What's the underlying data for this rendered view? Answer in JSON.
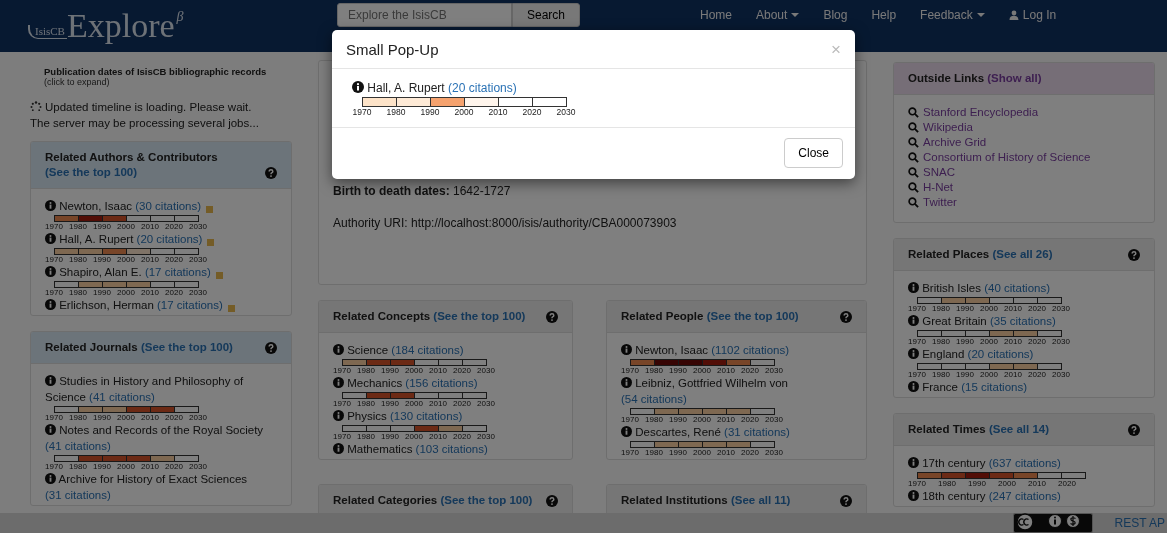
{
  "navbar": {
    "logo": "IsisCB",
    "brand": "Explore",
    "beta": "β",
    "search_placeholder": "Explore the IsisCB",
    "search_button": "Search",
    "links": [
      {
        "label": "Home",
        "kind": "plain"
      },
      {
        "label": "About",
        "kind": "dropdown"
      },
      {
        "label": "Blog",
        "kind": "plain"
      },
      {
        "label": "Help",
        "kind": "plain"
      },
      {
        "label": "Feedback",
        "kind": "dropdown"
      },
      {
        "label": "Log In",
        "kind": "user"
      }
    ]
  },
  "left": {
    "timeline_title": "Publication dates of IsisCB bibliographic records",
    "timeline_hint": "(click to expand)",
    "loading": [
      "Updated timeline is loading. Please wait.",
      "The server may be processing several jobs..."
    ],
    "panels": [
      {
        "kind": "info",
        "title": "Related Authors & Contributors",
        "link": "(See the top 100)",
        "help": true,
        "items": [
          {
            "name": "Newton, Isaac",
            "citations": "(30 citations)",
            "marked": true,
            "segments": [
              {
                "color": "#784528"
              },
              {
                "color": "#520e07"
              },
              {
                "color": "#6c2a15"
              },
              {
                "color": "#7f7f7f"
              },
              {
                "color": "#7f7f7f"
              },
              {
                "color": "#7f7f7f"
              }
            ],
            "ticks": [
              "1970",
              "1980",
              "1990",
              "2000",
              "2010",
              "2020",
              "2030"
            ]
          },
          {
            "name": "Hall, A. Rupert",
            "citations": "(20 citations)",
            "marked": true,
            "segments": [
              {
                "color": "#7e6851"
              },
              {
                "color": "#7e6851"
              },
              {
                "color": "#784528"
              },
              {
                "color": "#7f7367"
              },
              {
                "color": "#7f7f7f"
              },
              {
                "color": "#7f7f7f"
              }
            ],
            "ticks": [
              "1970",
              "1980",
              "1990",
              "2000",
              "2010",
              "2020",
              "2030"
            ]
          },
          {
            "name": "Shapiro, Alan E.",
            "citations": "(17 citations)",
            "marked": true,
            "segments": [
              {
                "color": "#7f7f7f"
              },
              {
                "color": "#7e6851"
              },
              {
                "color": "#7e6851"
              },
              {
                "color": "#7e6851"
              },
              {
                "color": "#7f7f7f"
              },
              {
                "color": "#7f7f7f"
              }
            ],
            "ticks": [
              "1970",
              "1980",
              "1990",
              "2000",
              "2010",
              "2020",
              "2030"
            ]
          },
          {
            "name": "Erlichson, Herman",
            "citations": "(17 citations)",
            "marked": true
          }
        ]
      },
      {
        "kind": "info",
        "title": "Related Journals",
        "link": "(See the top 100)",
        "help": true,
        "items": [
          {
            "name": "Studies in History and Philosophy of Science",
            "citations": "(41 citations)",
            "marked": false,
            "segments": [
              {
                "color": "#7f7f7f"
              },
              {
                "color": "#7e6851"
              },
              {
                "color": "#7e6851"
              },
              {
                "color": "#6c2a15"
              },
              {
                "color": "#6c2a15"
              },
              {
                "color": "#7f7f7f"
              }
            ],
            "ticks": [
              "1970",
              "1980",
              "1990",
              "2000",
              "2010",
              "2020",
              "2030"
            ]
          },
          {
            "name": "Notes and Records of the Royal Society",
            "citations": "(41 citations)",
            "marked": false,
            "segments": [
              {
                "color": "#7f7f7f"
              },
              {
                "color": "#6c2a15"
              },
              {
                "color": "#6c2a15"
              },
              {
                "color": "#6c2a15"
              },
              {
                "color": "#7e6851"
              },
              {
                "color": "#7f7f7f"
              }
            ],
            "ticks": [
              "1970",
              "1980",
              "1990",
              "2000",
              "2010",
              "2020",
              "2030"
            ]
          },
          {
            "name": "Archive for History of Exact Sciences",
            "citations": "(31 citations)",
            "marked": false
          }
        ]
      }
    ]
  },
  "middle": {
    "fields": [
      {
        "label": "Birth to death dates:",
        "value": "1642-1727",
        "strong": true
      },
      {
        "label": "Authority URI:",
        "value": "http://localhost:8000/isis/authority/CBA000073903",
        "strong": false
      }
    ],
    "panels": [
      {
        "kind": "plain",
        "title": "Related Concepts",
        "link": "(See the top 100)",
        "help": true,
        "items": [
          {
            "name": "Science",
            "citations": "(184 citations)",
            "marked": false,
            "segments": [
              {
                "color": "#7e6851"
              },
              {
                "color": "#6c2a15"
              },
              {
                "color": "#6c2a15"
              },
              {
                "color": "#7f7f7f"
              },
              {
                "color": "#7f7f7f"
              },
              {
                "color": "#7f7f7f"
              }
            ],
            "ticks": [
              "1970",
              "1980",
              "1990",
              "2000",
              "2010",
              "2020",
              "2030"
            ]
          },
          {
            "name": "Mechanics",
            "citations": "(156 citations)",
            "marked": false,
            "segments": [
              {
                "color": "#7f7f7f"
              },
              {
                "color": "#6c2a15"
              },
              {
                "color": "#6c2a15"
              },
              {
                "color": "#7f7f7f"
              },
              {
                "color": "#7f7f7f"
              },
              {
                "color": "#7f7f7f"
              }
            ],
            "ticks": [
              "1970",
              "1980",
              "1990",
              "2000",
              "2010",
              "2020",
              "2030"
            ]
          },
          {
            "name": "Physics",
            "citations": "(130 citations)",
            "marked": false,
            "segments": [
              {
                "color": "#7f7f7f"
              },
              {
                "color": "#7f7f7f"
              },
              {
                "color": "#7f7f7f"
              },
              {
                "color": "#6c2a15"
              },
              {
                "color": "#7e6851"
              },
              {
                "color": "#7f7f7f"
              }
            ],
            "ticks": [
              "1970",
              "1980",
              "1990",
              "2000",
              "2010",
              "2020",
              "2030"
            ]
          },
          {
            "name": "Mathematics",
            "citations": "(103 citations)",
            "marked": false
          }
        ]
      },
      {
        "kind": "plain",
        "title": "Related People",
        "link": "(See the top 100)",
        "help": true,
        "items": [
          {
            "name": "Newton, Isaac",
            "citations": "(1102 citations)",
            "marked": false,
            "segments": [
              {
                "color": "#784528"
              },
              {
                "color": "#370504"
              },
              {
                "color": "#370504"
              },
              {
                "color": "#520e07"
              },
              {
                "color": "#784528"
              },
              {
                "color": "#7f7f7f"
              }
            ],
            "ticks": [
              "1970",
              "1980",
              "1990",
              "2000",
              "2010",
              "2020",
              "2030"
            ]
          },
          {
            "name": "Leibniz, Gottfried Wilhelm von",
            "citations": "(54 citations)",
            "marked": false,
            "segments": [
              {
                "color": "#7f7f7f"
              },
              {
                "color": "#7e6851"
              },
              {
                "color": "#7e6851"
              },
              {
                "color": "#7e6851"
              },
              {
                "color": "#7e6851"
              },
              {
                "color": "#7f7f7f"
              }
            ],
            "ticks": [
              "1970",
              "1980",
              "1990",
              "2000",
              "2010",
              "2020",
              "2030"
            ]
          },
          {
            "name": "Descartes, René",
            "citations": "(31 citations)",
            "marked": false,
            "segments": [
              {
                "color": "#7f7f7f"
              },
              {
                "color": "#7e6851"
              },
              {
                "color": "#7e6851"
              },
              {
                "color": "#7e6851"
              },
              {
                "color": "#7e6851"
              },
              {
                "color": "#7f7f7f"
              }
            ],
            "ticks": [
              "1970",
              "1980",
              "1990",
              "2000",
              "2010",
              "2020",
              "2030"
            ]
          }
        ]
      },
      {
        "kind": "plain",
        "title": "Related Categories",
        "link": "(See the top 100)",
        "help": true
      },
      {
        "kind": "plain",
        "title": "Related Institutions",
        "link": "(See all 11)",
        "help": true
      }
    ]
  },
  "right": {
    "panels": [
      {
        "kind": "links",
        "title": "Outside Links",
        "link": "(Show all)",
        "help": false,
        "links": [
          "Stanford Encyclopedia",
          "Wikipedia",
          "Archive Grid",
          "Consortium of History of Science",
          "SNAC",
          "H-Net",
          "Twitter"
        ]
      },
      {
        "kind": "plain",
        "title": "Related Places",
        "link": "(See all 26)",
        "help": true,
        "items": [
          {
            "name": "British Isles",
            "citations": "(40 citations)",
            "marked": false,
            "segments": [
              {
                "color": "#7f7f7f"
              },
              {
                "color": "#7e6851"
              },
              {
                "color": "#7e6851"
              },
              {
                "color": "#7f7f7f"
              },
              {
                "color": "#7f7f7f"
              },
              {
                "color": "#7f7f7f"
              }
            ],
            "ticks": [
              "1970",
              "1980",
              "1990",
              "2000",
              "2010",
              "2020",
              "2030"
            ]
          },
          {
            "name": "Great Britain",
            "citations": "(35 citations)",
            "marked": false,
            "segments": [
              {
                "color": "#7f7f7f"
              },
              {
                "color": "#7f7f7f"
              },
              {
                "color": "#7f7f7f"
              },
              {
                "color": "#7e6851"
              },
              {
                "color": "#7e6851"
              },
              {
                "color": "#7f7f7f"
              }
            ],
            "ticks": [
              "1970",
              "1980",
              "1990",
              "2000",
              "2010",
              "2020",
              "2030"
            ]
          },
          {
            "name": "England",
            "citations": "(20 citations)",
            "marked": false,
            "segments": [
              {
                "color": "#7f7f7f"
              },
              {
                "color": "#7f7f7f"
              },
              {
                "color": "#7f7f7f"
              },
              {
                "color": "#7e6851"
              },
              {
                "color": "#7e6851"
              },
              {
                "color": "#7f7f7f"
              }
            ],
            "ticks": [
              "1970",
              "1980",
              "1990",
              "2000",
              "2010",
              "2020",
              "2030"
            ]
          },
          {
            "name": "France",
            "citations": "(15 citations)",
            "marked": false
          }
        ]
      },
      {
        "kind": "plain",
        "title": "Related Times",
        "link": "(See all 14)",
        "help": true,
        "items": [
          {
            "name": "17th century",
            "citations": "(637 citations)",
            "marked": false,
            "segments": [
              {
                "color": "#784528"
              },
              {
                "color": "#6c2a15"
              },
              {
                "color": "#520e07"
              },
              {
                "color": "#6c2a15"
              },
              {
                "color": "#784528"
              },
              {
                "color": "#7f7f7f"
              },
              {
                "color": "#7f7f7f"
              }
            ],
            "ticks": [
              "1970",
              "1980",
              "1990",
              "2000",
              "2010",
              "2020"
            ]
          },
          {
            "name": "18th century",
            "citations": "(247 citations)",
            "marked": false
          }
        ]
      }
    ]
  },
  "footer": {
    "api_link": "REST AP"
  },
  "modal": {
    "title": "Small Pop-Up",
    "close_glyph": "×",
    "item": {
      "name": "Hall, A. Rupert",
      "citations": "(20 citations)",
      "segments": [
        {
          "color": "#fde3c8"
        },
        {
          "color": "#feead6"
        },
        {
          "color": "#f5a26e"
        },
        {
          "color": "#fff5ec"
        },
        {
          "color": "#ffffff"
        },
        {
          "color": "#ffffff"
        }
      ],
      "ticks": [
        "1970",
        "1980",
        "1990",
        "2000",
        "2010",
        "2020",
        "2030"
      ]
    },
    "button": "Close"
  }
}
